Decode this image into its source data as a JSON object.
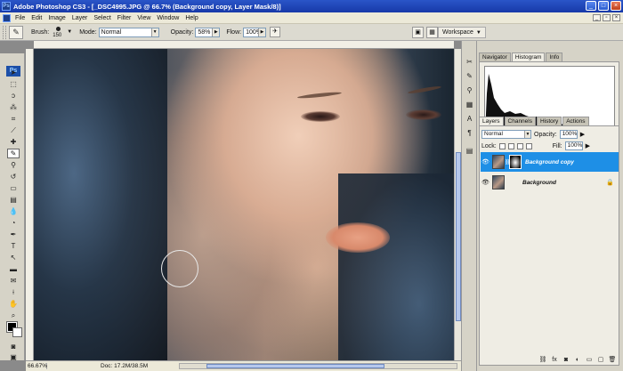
{
  "window": {
    "title": "Adobe Photoshop CS3 - [_DSC4995.JPG @ 66.7% (Background copy, Layer Mask/8)]",
    "controls": [
      "_",
      "□",
      "×"
    ]
  },
  "menu": {
    "items": [
      "File",
      "Edit",
      "Image",
      "Layer",
      "Select",
      "Filter",
      "View",
      "Window",
      "Help"
    ]
  },
  "options_bar": {
    "brush_label": "Brush:",
    "brush_size": "150",
    "mode_label": "Mode:",
    "mode_value": "Normal",
    "opacity_label": "Opacity:",
    "opacity_value": "58%",
    "flow_label": "Flow:",
    "flow_value": "100%",
    "workspace_label": "Workspace"
  },
  "status_bar": {
    "zoom": "66.67%",
    "doc": "Doc: 17.2M/38.5M"
  },
  "top_panel": {
    "tabs": [
      "Navigator",
      "Histogram",
      "Info"
    ],
    "active_tab": "Histogram"
  },
  "layers_panel": {
    "tabs": [
      "Layers",
      "Channels",
      "History",
      "Actions"
    ],
    "active_tab": "Layers",
    "blend_mode": "Normal",
    "opacity_label": "Opacity:",
    "opacity_value": "100%",
    "lock_label": "Lock:",
    "fill_label": "Fill:",
    "fill_value": "100%",
    "layers": [
      {
        "name": "Background copy",
        "selected": true,
        "has_mask": true
      },
      {
        "name": "Background",
        "selected": false,
        "locked": true
      }
    ]
  },
  "colors": {
    "title_bar": "#1f49b8",
    "selected_layer": "#1e8fe6",
    "foreground": "#000000",
    "background": "#ffffff"
  }
}
